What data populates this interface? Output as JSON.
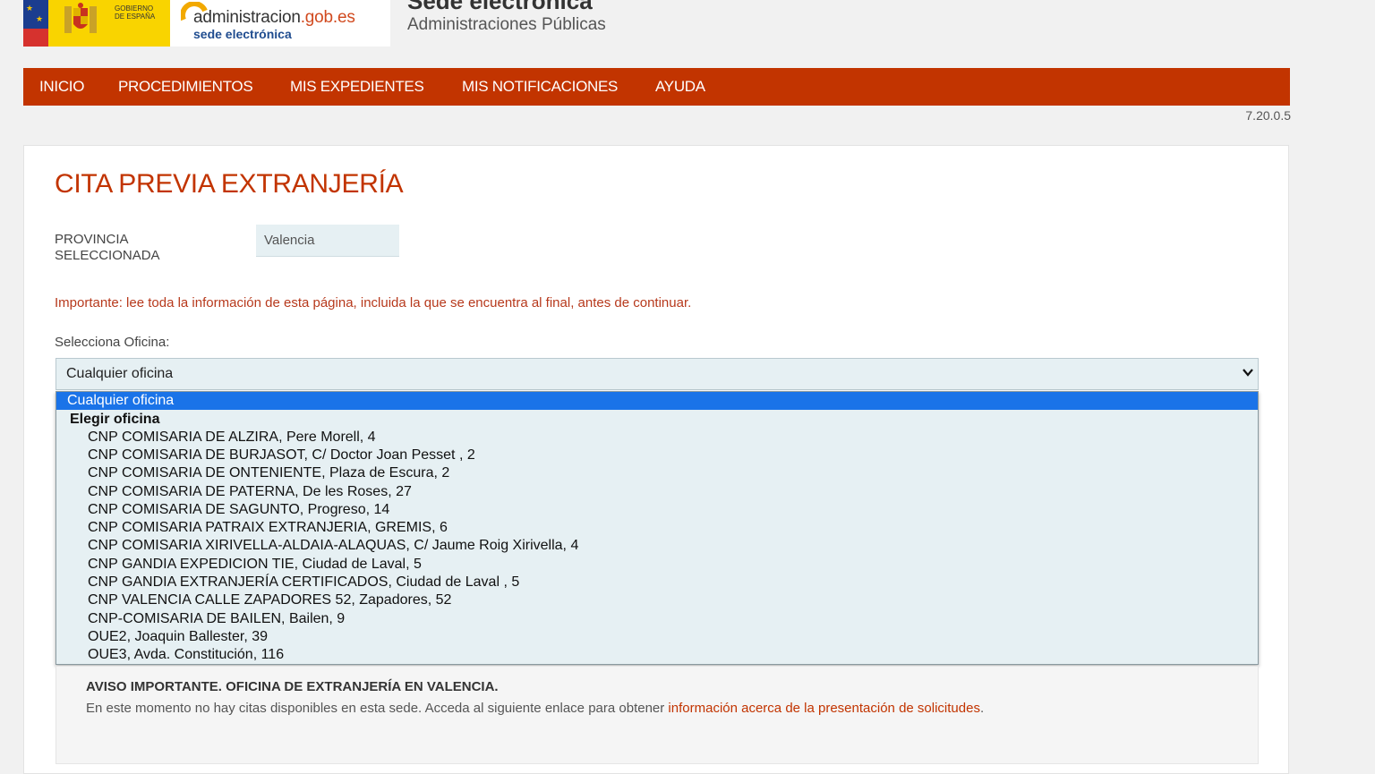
{
  "header": {
    "gob_text_line1": "GOBIERNO",
    "gob_text_line2": "DE ESPAÑA",
    "admin_logo_main": "administracion",
    "admin_logo_domain": ".gob.es",
    "admin_logo_sub": "sede electrónica",
    "site_title": "Sede electrónica",
    "site_subtitle": "Administraciones Públicas"
  },
  "nav": {
    "items": [
      {
        "label": "INICIO"
      },
      {
        "label": "PROCEDIMIENTOS"
      },
      {
        "label": "MIS EXPEDIENTES"
      },
      {
        "label": "MIS NOTIFICACIONES"
      },
      {
        "label": "AYUDA"
      }
    ]
  },
  "version": "7.20.0.5",
  "main": {
    "title": "CITA PREVIA EXTRANJERÍA",
    "provincia_label_line1": "PROVINCIA",
    "provincia_label_line2": "SELECCIONADA",
    "provincia_value": "Valencia",
    "important_notice": "Importante: lee toda la información de esta página, incluida la que se encuentra al final, antes de continuar.",
    "select_label": "Selecciona Oficina:",
    "select_value": "Cualquier oficina"
  },
  "dropdown": {
    "selected_option": "Cualquier oficina",
    "group_label": "Elegir oficina",
    "options": [
      "CNP COMISARIA DE ALZIRA, Pere Morell, 4",
      "CNP COMISARIA DE BURJASOT, C/ Doctor Joan Pesset , 2",
      "CNP COMISARIA DE ONTENIENTE, Plaza de Escura, 2",
      "CNP COMISARIA DE PATERNA, De les Roses, 27",
      "CNP COMISARIA DE SAGUNTO, Progreso, 14",
      "CNP COMISARIA PATRAIX EXTRANJERIA, GREMIS, 6",
      "CNP COMISARIA XIRIVELLA-ALDAIA-ALAQUAS, C/ Jaume Roig Xirivella, 4",
      "CNP GANDIA EXPEDICION TIE, Ciudad de Laval, 5",
      "CNP GANDIA EXTRANJERÍA CERTIFICADOS, Ciudad de Laval , 5",
      "CNP VALENCIA CALLE ZAPADORES 52, Zapadores, 52",
      "CNP-COMISARIA DE BAILEN, Bailen, 9",
      "OUE2, Joaquin Ballester, 39",
      "OUE3, Avda. Constitución, 116"
    ]
  },
  "aviso": {
    "title": "AVISO IMPORTANTE. OFICINA DE EXTRANJERÍA EN VALENCIA.",
    "text": "En este momento no hay citas disponibles en esta sede. Acceda al siguiente enlace para obtener ",
    "link": "información acerca de la presentación de solicitudes",
    "text_end": "."
  },
  "colors": {
    "accent": "#c23400",
    "select_bg": "#e6f0f3",
    "option_highlight": "#1a73e8"
  }
}
